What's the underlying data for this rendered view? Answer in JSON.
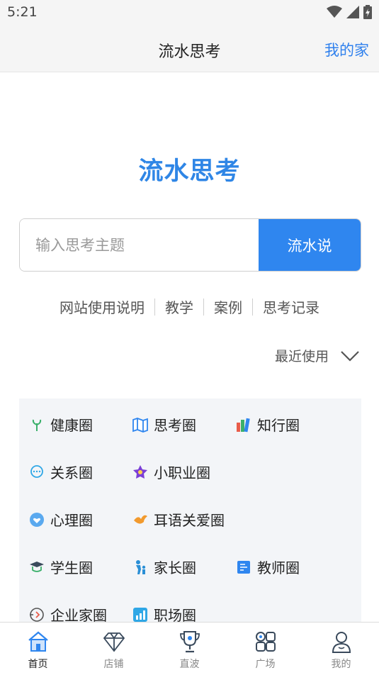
{
  "status_bar": {
    "time": "5:21"
  },
  "app_bar": {
    "title": "流水思考",
    "action": "我的家"
  },
  "hero": {
    "title": "流水思考"
  },
  "search": {
    "placeholder": "输入思考主题",
    "button": "流水说"
  },
  "links": [
    "网站使用说明",
    "教学",
    "案例",
    "思考记录"
  ],
  "recent": {
    "label": "最近使用"
  },
  "circles": [
    {
      "label": "健康圈",
      "icon": "sprout-icon"
    },
    {
      "label": "思考圈",
      "icon": "map-icon"
    },
    {
      "label": "知行圈",
      "icon": "books-icon"
    },
    {
      "label": "关系圈",
      "icon": "chat-icon"
    },
    {
      "label": "小职业圈",
      "icon": "star-badge-icon"
    },
    {
      "label": "心理圈",
      "icon": "heart-face-icon"
    },
    {
      "label": "耳语关爱圈",
      "icon": "bird-icon"
    },
    {
      "label": "学生圈",
      "icon": "graduation-cap-icon"
    },
    {
      "label": "家长圈",
      "icon": "parent-child-icon"
    },
    {
      "label": "教师圈",
      "icon": "teacher-board-icon"
    },
    {
      "label": "企业家圈",
      "icon": "building-icon"
    },
    {
      "label": "职场圈",
      "icon": "bar-chart-icon"
    }
  ],
  "tabs": [
    {
      "label": "首页",
      "icon": "home-icon",
      "active": true
    },
    {
      "label": "店铺",
      "icon": "diamond-icon",
      "active": false
    },
    {
      "label": "直波",
      "icon": "trophy-icon",
      "active": false
    },
    {
      "label": "广场",
      "icon": "apps-grid-icon",
      "active": false
    },
    {
      "label": "我的",
      "icon": "user-icon",
      "active": false
    }
  ],
  "colors": {
    "accent": "#2f86ef",
    "title": "#2f86e6",
    "panel": "#f3f5f8"
  }
}
